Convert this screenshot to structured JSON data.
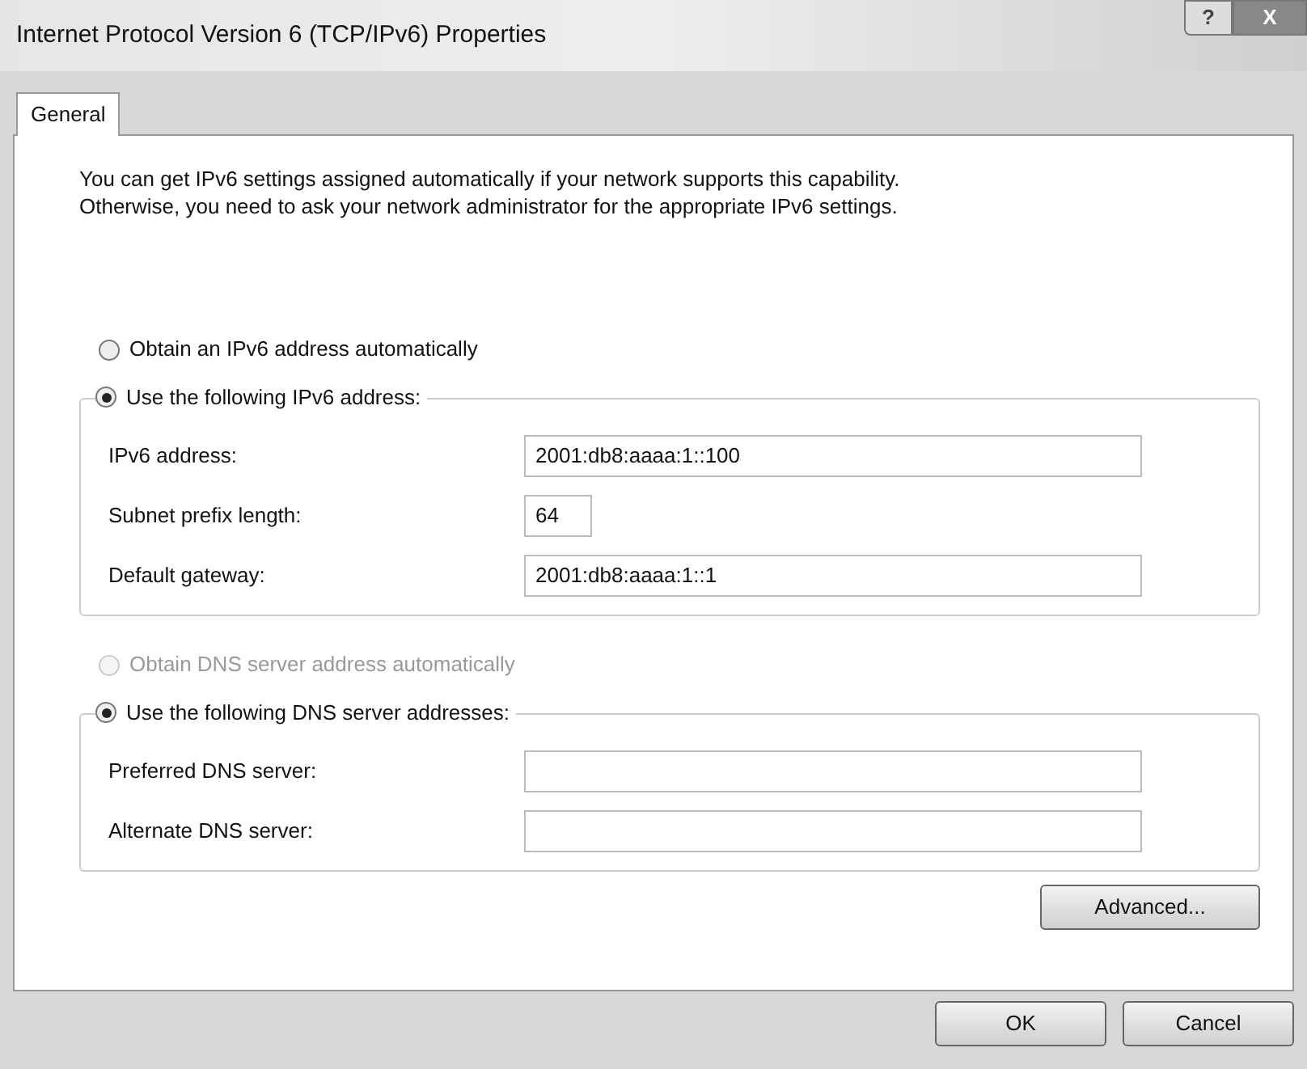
{
  "window": {
    "title": "Internet Protocol Version 6 (TCP/IPv6) Properties",
    "help_button": "?",
    "close_button": "X"
  },
  "tabs": [
    {
      "label": "General",
      "selected": true
    }
  ],
  "description": [
    "You can get IPv6 settings assigned automatically if your network supports this capability.",
    "Otherwise, you need to ask your network administrator for the appropriate IPv6 settings."
  ],
  "address": {
    "auto_option": {
      "label": "Obtain an IPv6 address automatically",
      "selected": false,
      "disabled": false
    },
    "manual_option": {
      "label": "Use the following IPv6 address:",
      "selected": true,
      "disabled": false
    },
    "fields": [
      {
        "label": "IPv6 address:",
        "value": "2001:db8:aaaa:1::100",
        "kind": "wide"
      },
      {
        "label": "Subnet prefix length:",
        "value": "64",
        "kind": "short"
      },
      {
        "label": "Default gateway:",
        "value": "2001:db8:aaaa:1::1",
        "kind": "wide"
      }
    ]
  },
  "dns": {
    "auto_option": {
      "label": "Obtain DNS server address automatically",
      "selected": false,
      "disabled": true
    },
    "manual_option": {
      "label": "Use the following DNS server addresses:",
      "selected": true,
      "disabled": false
    },
    "fields": [
      {
        "label": "Preferred DNS server:",
        "kind": "wide"
      },
      {
        "label": "Alternate DNS server:",
        "kind": "wide"
      }
    ]
  },
  "advanced_button": "Advanced...",
  "buttons": [
    "OK",
    "Cancel"
  ]
}
